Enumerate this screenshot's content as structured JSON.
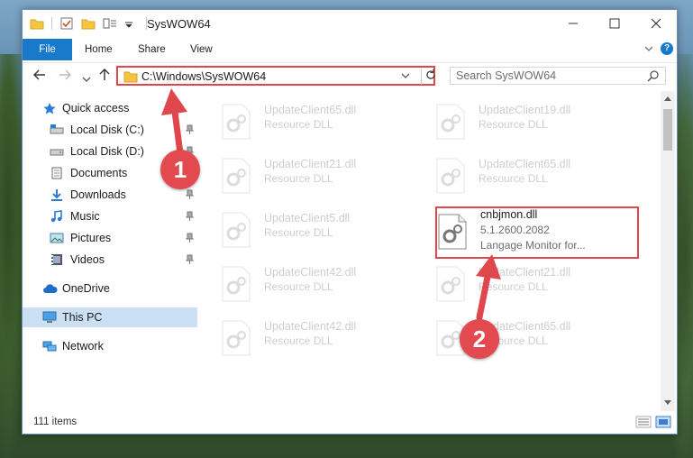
{
  "window": {
    "title": "SysWOW64",
    "minimize_icon": "minimize-icon",
    "maximize_icon": "maximize-icon",
    "close_icon": "close-icon"
  },
  "ribbon": {
    "tabs": [
      {
        "label": "File"
      },
      {
        "label": "Home"
      },
      {
        "label": "Share"
      },
      {
        "label": "View"
      }
    ],
    "help_label": "?"
  },
  "address": {
    "path": "C:\\Windows\\SysWOW64",
    "search_placeholder": "Search SysWOW64"
  },
  "nav": {
    "items": [
      {
        "label": "Quick access",
        "icon": "star-icon",
        "pinned": false
      },
      {
        "label": "Local Disk (C:)",
        "icon": "drive-icon",
        "pinned": true
      },
      {
        "label": "Local Disk (D:)",
        "icon": "drive-icon",
        "pinned": true
      },
      {
        "label": "Documents",
        "icon": "documents-icon",
        "pinned": true
      },
      {
        "label": "Downloads",
        "icon": "downloads-icon",
        "pinned": true
      },
      {
        "label": "Music",
        "icon": "music-icon",
        "pinned": true
      },
      {
        "label": "Pictures",
        "icon": "pictures-icon",
        "pinned": true
      },
      {
        "label": "Videos",
        "icon": "videos-icon",
        "pinned": true
      },
      {
        "label": "OneDrive",
        "icon": "onedrive-icon",
        "pinned": false
      },
      {
        "label": "This PC",
        "icon": "this-pc-icon",
        "pinned": false,
        "selected": true
      },
      {
        "label": "Network",
        "icon": "network-icon",
        "pinned": false
      }
    ]
  },
  "files": [
    {
      "name": "UpdateClient65.dll",
      "sub": "Resource DLL",
      "faded": true
    },
    {
      "name": "UpdateClient19.dll",
      "sub": "Resource DLL",
      "faded": true
    },
    {
      "name": "UpdateClient21.dll",
      "sub": "Resource DLL",
      "faded": true
    },
    {
      "name": "UpdateClient65.dll",
      "sub": "Resource DLL",
      "faded": true
    },
    {
      "name": "UpdateClient5.dll",
      "sub": "Resource DLL",
      "faded": true
    },
    {
      "name": "cnbjmon.dll",
      "version": "5.1.2600.2082",
      "sub": "Langage Monitor for...",
      "faded": false
    },
    {
      "name": "UpdateClient42.dll",
      "sub": "Resource DLL",
      "faded": true
    },
    {
      "name": "UpdateClient21.dll",
      "sub": "Resource DLL",
      "faded": true
    },
    {
      "name": "UpdateClient42.dll",
      "sub": "Resource DLL",
      "faded": true
    },
    {
      "name": "UpdateClient65.dll",
      "sub": "Resource DLL",
      "faded": true
    }
  ],
  "status": {
    "items_count": "111 items"
  },
  "callouts": [
    {
      "label": "1"
    },
    {
      "label": "2"
    }
  ],
  "colors": {
    "accent": "#1979ca",
    "highlight_red": "#e0474c",
    "selected_nav": "#cce0f3"
  }
}
